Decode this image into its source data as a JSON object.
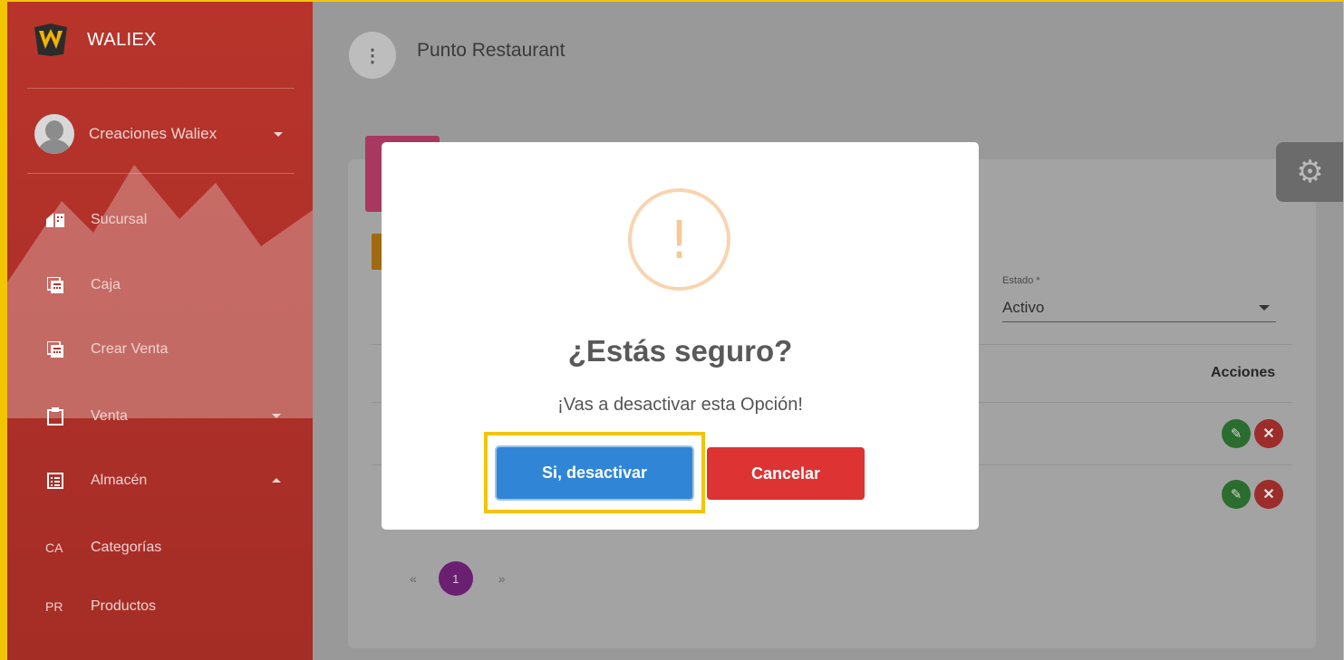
{
  "brand": {
    "name": "WALIEX"
  },
  "user": {
    "name": "Creaciones Waliex"
  },
  "sidebar": {
    "items": [
      {
        "label": "Sucursal",
        "icon": "store-icon"
      },
      {
        "label": "Caja",
        "icon": "calculator-icon"
      },
      {
        "label": "Crear Venta",
        "icon": "calculator-icon"
      },
      {
        "label": "Venta",
        "icon": "clipboard-icon"
      },
      {
        "label": "Almacén",
        "icon": "list-icon"
      }
    ],
    "subitems": [
      {
        "abbr": "CA",
        "label": "Categorías"
      },
      {
        "abbr": "PR",
        "label": "Productos"
      }
    ]
  },
  "header": {
    "title": "Punto Restaurant"
  },
  "filters": {
    "estado_label": "Estado *",
    "estado_value": "Activo"
  },
  "table": {
    "actions_header": "Acciones"
  },
  "pagination": {
    "prev": "«",
    "current": "1",
    "next": "»"
  },
  "modal": {
    "title": "¿Estás seguro?",
    "text": "¡Vas a desactivar esta Opción!",
    "confirm_label": "Si, desactivar",
    "cancel_label": "Cancelar"
  },
  "colors": {
    "sidebar": "#b8342b",
    "confirm": "#3085d6",
    "cancel": "#dd3333",
    "warning": "#f8bb86",
    "highlight": "#f2c500"
  }
}
